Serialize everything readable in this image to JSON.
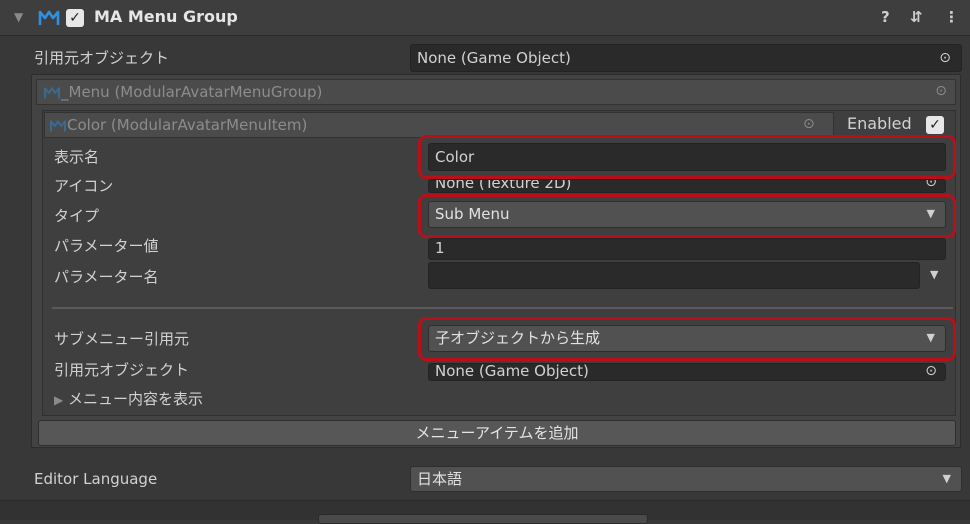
{
  "header": {
    "title": "MA Menu Group",
    "enabled_check": "✓",
    "help_icon": "?",
    "settings_icon": "⇵",
    "more_icon": "⋮"
  },
  "source_object": {
    "label": "引用元オブジェクト",
    "value": "None (Game Object)"
  },
  "menu_group": {
    "title": "_Menu (ModularAvatarMenuGroup)"
  },
  "menu_item": {
    "title": "Color (ModularAvatarMenuItem)",
    "enabled_label": "Enabled",
    "enabled_check": "✓",
    "display_name": {
      "label": "表示名",
      "value": "Color"
    },
    "icon": {
      "label": "アイコン",
      "value": "None (Texture 2D)"
    },
    "type": {
      "label": "タイプ",
      "value": "Sub Menu"
    },
    "param_value": {
      "label": "パラメーター値",
      "value": "1"
    },
    "param_name": {
      "label": "パラメーター名",
      "value": ""
    },
    "submenu_source": {
      "label": "サブメニュー引用元",
      "value": "子オブジェクトから生成"
    },
    "source_object": {
      "label": "引用元オブジェクト",
      "value": "None (Game Object)"
    },
    "show_contents": {
      "label": "メニュー内容を表示"
    }
  },
  "add_item_button": "メニューアイテムを追加",
  "editor_language": {
    "label": "Editor Language",
    "value": "日本語"
  },
  "colors": {
    "highlight": "#b8101a",
    "accent": "#2f8fe0"
  }
}
